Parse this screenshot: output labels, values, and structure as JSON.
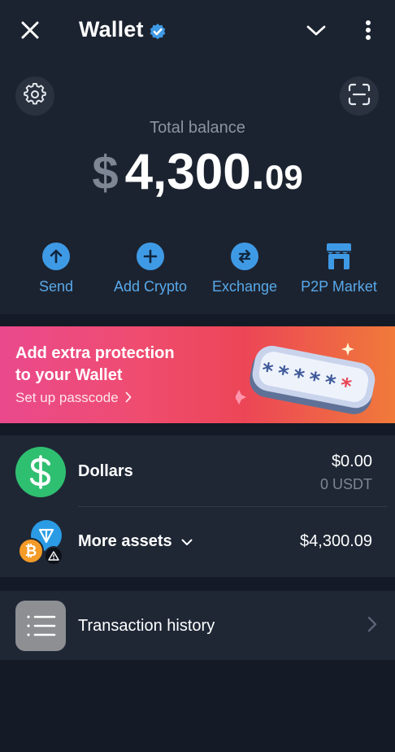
{
  "header": {
    "title": "Wallet",
    "close_icon": "close-icon",
    "verified_icon": "verified-badge-icon",
    "dropdown_icon": "chevron-down-icon",
    "more_icon": "more-vertical-icon"
  },
  "top_buttons": {
    "settings_icon": "gear-icon",
    "scan_icon": "scan-qr-icon"
  },
  "balance": {
    "label": "Total balance",
    "currency_symbol": "$",
    "integer_part": "4,300.",
    "decimal_part": "09"
  },
  "actions": [
    {
      "label": "Send",
      "icon": "arrow-up-icon"
    },
    {
      "label": "Add Crypto",
      "icon": "plus-icon"
    },
    {
      "label": "Exchange",
      "icon": "swap-arrows-icon"
    },
    {
      "label": "P2P Market",
      "icon": "store-icon"
    }
  ],
  "promo": {
    "title_line1": "Add extra protection",
    "title_line2": "to your Wallet",
    "link": "Set up passcode",
    "art_text": "*****",
    "art_star": "*"
  },
  "assets": {
    "dollars": {
      "name": "Dollars",
      "value": "$0.00",
      "sub_value": "0 USDT",
      "icon": "dollar-icon"
    },
    "more": {
      "name": "More assets",
      "value": "$4,300.09",
      "icons": [
        "ton-icon",
        "bitcoin-icon",
        "warning-icon"
      ]
    }
  },
  "history": {
    "label": "Transaction history",
    "icon": "list-icon"
  },
  "colors": {
    "background": "#1c2330",
    "accent": "#3f9ae6",
    "dollar_green": "#2fbf71"
  }
}
